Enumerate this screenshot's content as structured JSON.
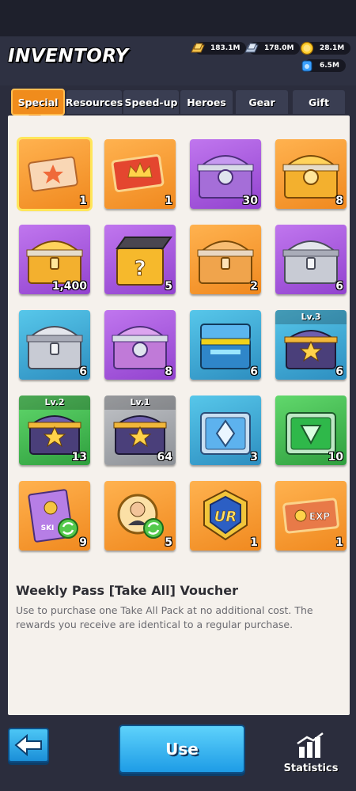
{
  "header": {
    "title": "INVENTORY",
    "resources": [
      {
        "icon": "gold-bar-icon",
        "value": "183.1M"
      },
      {
        "icon": "steel-ingot-icon",
        "value": "178.0M"
      },
      {
        "icon": "coin-icon",
        "value": "28.1M"
      },
      {
        "icon": "blue-crystal-icon",
        "value": "6.5M"
      }
    ]
  },
  "tabs": [
    {
      "label": "Special",
      "active": true
    },
    {
      "label": "Resources",
      "active": false
    },
    {
      "label": "Speed-up",
      "active": false
    },
    {
      "label": "Heroes",
      "active": false
    },
    {
      "label": "Gear",
      "active": false
    },
    {
      "label": "Gift",
      "active": false
    }
  ],
  "items": [
    {
      "icon": "voucher-ticket-icon",
      "qty": "1",
      "bg": "orange",
      "selected": true
    },
    {
      "icon": "crown-ticket-icon",
      "qty": "1",
      "bg": "orange"
    },
    {
      "icon": "purple-chest-icon",
      "qty": "30",
      "bg": "purple"
    },
    {
      "icon": "gold-chest-icon",
      "qty": "8",
      "bg": "orange"
    },
    {
      "icon": "gold-chest-icon",
      "qty": "1,400",
      "bg": "purple"
    },
    {
      "icon": "mystery-box-icon",
      "qty": "5",
      "bg": "purple"
    },
    {
      "icon": "orange-chest-icon",
      "qty": "2",
      "bg": "orange"
    },
    {
      "icon": "silver-chest-icon",
      "qty": "6",
      "bg": "purple"
    },
    {
      "icon": "silver-chest-icon",
      "qty": "6",
      "bg": "blue"
    },
    {
      "icon": "purple-chest-icon",
      "qty": "8",
      "bg": "purple"
    },
    {
      "icon": "tech-chest-icon",
      "qty": "6",
      "bg": "blue"
    },
    {
      "icon": "star-chest-icon",
      "qty": "6",
      "bg": "blue",
      "level": "Lv.3"
    },
    {
      "icon": "star-chest-icon",
      "qty": "13",
      "bg": "green",
      "level": "Lv.2"
    },
    {
      "icon": "star-chest-icon",
      "qty": "64",
      "bg": "gray",
      "level": "Lv.1"
    },
    {
      "icon": "crystal-chest-icon",
      "qty": "3",
      "bg": "blue"
    },
    {
      "icon": "emerald-chest-icon",
      "qty": "10",
      "bg": "green"
    },
    {
      "icon": "skill-book-icon",
      "qty": "9",
      "bg": "orange"
    },
    {
      "icon": "hero-swap-icon",
      "qty": "5",
      "bg": "orange"
    },
    {
      "icon": "ur-badge-icon",
      "qty": "1",
      "bg": "orange"
    },
    {
      "icon": "exp-ticket-icon",
      "qty": "1",
      "bg": "orange"
    }
  ],
  "item_text": {
    "ur": "UR",
    "exp": "EXP",
    "skill": "SKI"
  },
  "description": {
    "title": "Weekly Pass [Take All] Voucher",
    "text": "Use to purchase one Take All Pack at no additional cost. The rewards you receive are identical to a regular purchase."
  },
  "footer": {
    "back_icon": "arrow-left-icon",
    "use_label": "Use",
    "stats_icon": "bar-chart-icon",
    "stats_label": "Statistics"
  }
}
